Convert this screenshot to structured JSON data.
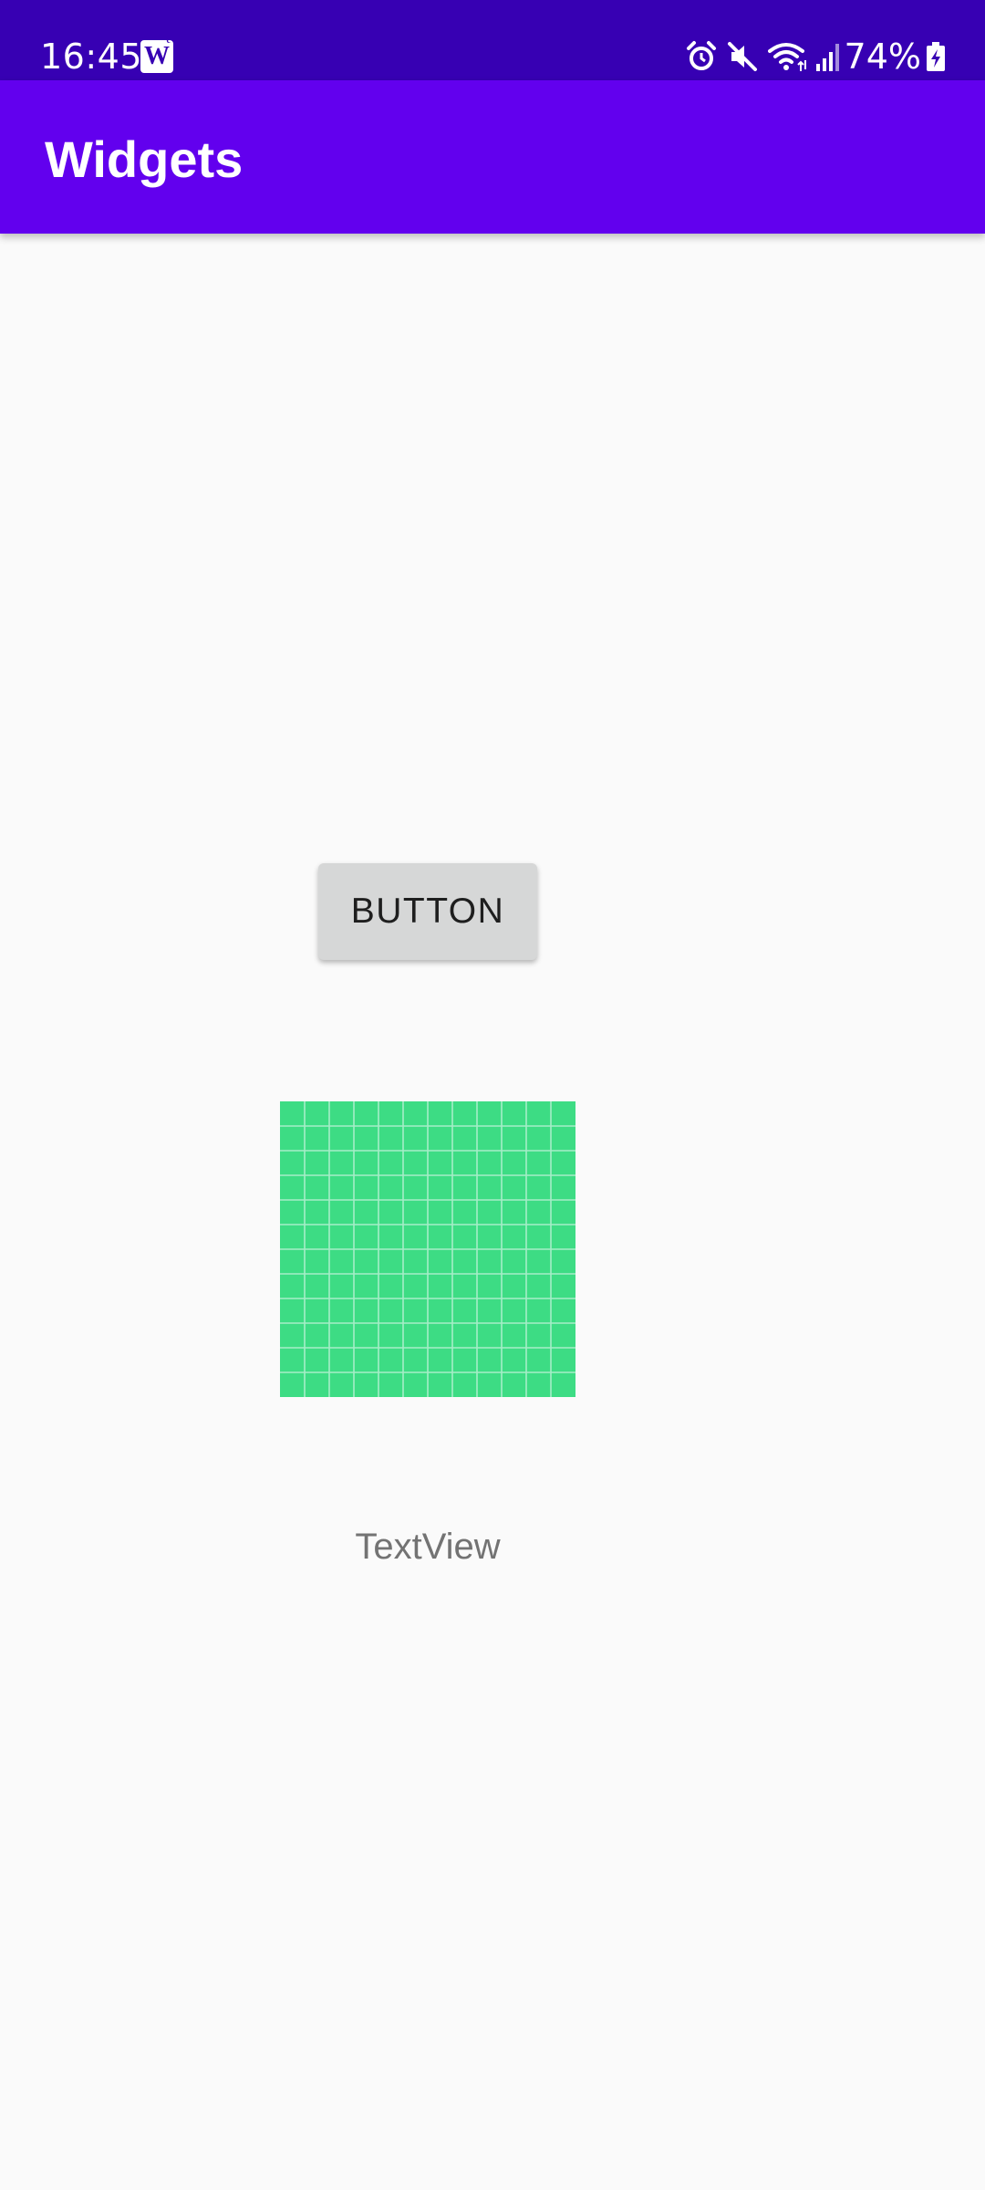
{
  "status_bar": {
    "time": "16:45",
    "notification_app": "W",
    "battery_percent": "74%",
    "icons": [
      "alarm-icon",
      "mute-icon",
      "wifi-icon",
      "signal-icon",
      "battery-charging-icon"
    ]
  },
  "app_bar": {
    "title": "Widgets"
  },
  "content": {
    "button_label": "BUTTON",
    "text_view": "TextView",
    "image_icon": "grid-placeholder-image"
  },
  "colors": {
    "status_bar": "#3700b3",
    "app_bar": "#6200ee",
    "background": "#fafafa",
    "button": "#d6d7d7",
    "image": "#3ddc84"
  }
}
